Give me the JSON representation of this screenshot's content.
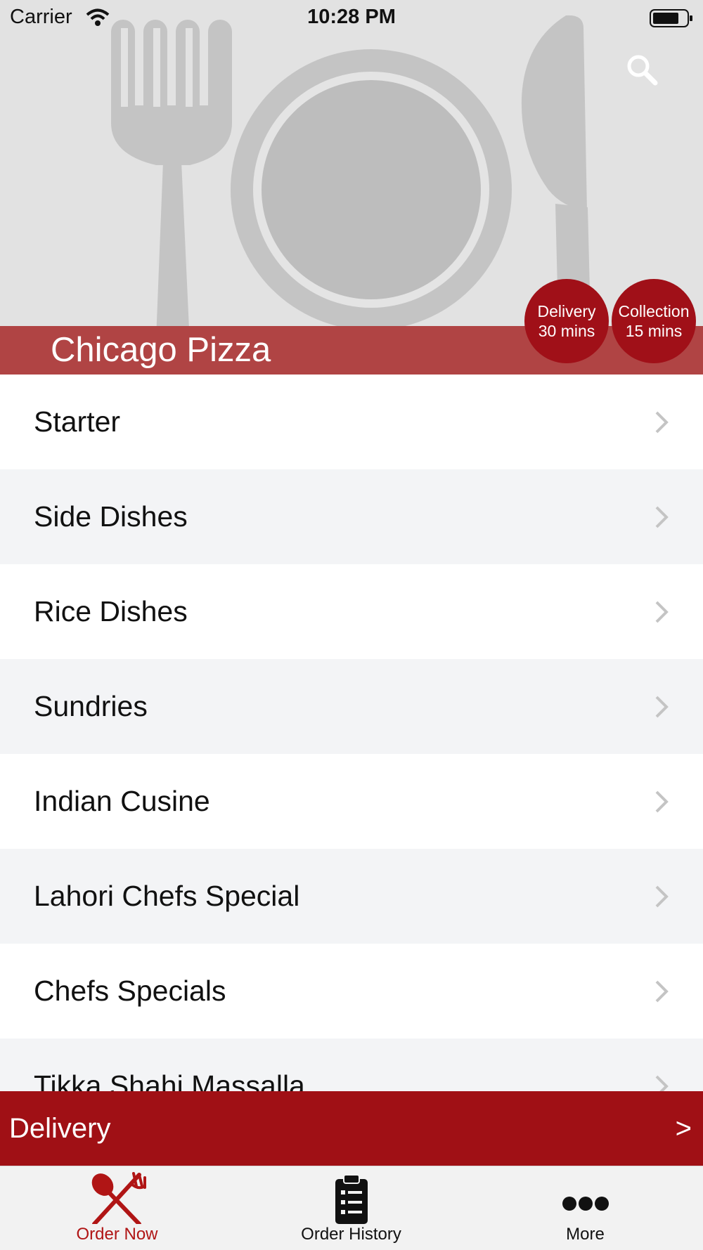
{
  "status_bar": {
    "carrier": "Carrier",
    "time": "10:28 PM"
  },
  "restaurant": {
    "name": "Chicago Pizza",
    "delivery_badge": {
      "line1": "Delivery",
      "line2": "30 mins"
    },
    "collection_badge": {
      "line1": "Collection",
      "line2": "15 mins"
    }
  },
  "menu": {
    "categories": [
      "Starter",
      "Side Dishes",
      "Rice Dishes",
      "Sundries",
      "Indian Cusine",
      "Lahori Chefs Special",
      "Chefs Specials",
      "Tikka Shahi Massalla"
    ]
  },
  "order_bar": {
    "label": "Delivery",
    "arrow": ">"
  },
  "tab_bar": {
    "tabs": [
      {
        "label": "Order Now",
        "icon": "fork-spoon-icon",
        "active": true
      },
      {
        "label": "Order History",
        "icon": "clipboard-list-icon",
        "active": false
      },
      {
        "label": "More",
        "icon": "more-dots-icon",
        "active": false
      }
    ]
  },
  "colors": {
    "brand_red": "#a01015",
    "title_band": "#b04444",
    "active_tab": "#b01515"
  },
  "icons": [
    "wifi-icon",
    "battery-icon",
    "search-icon",
    "chevron-right-icon"
  ]
}
